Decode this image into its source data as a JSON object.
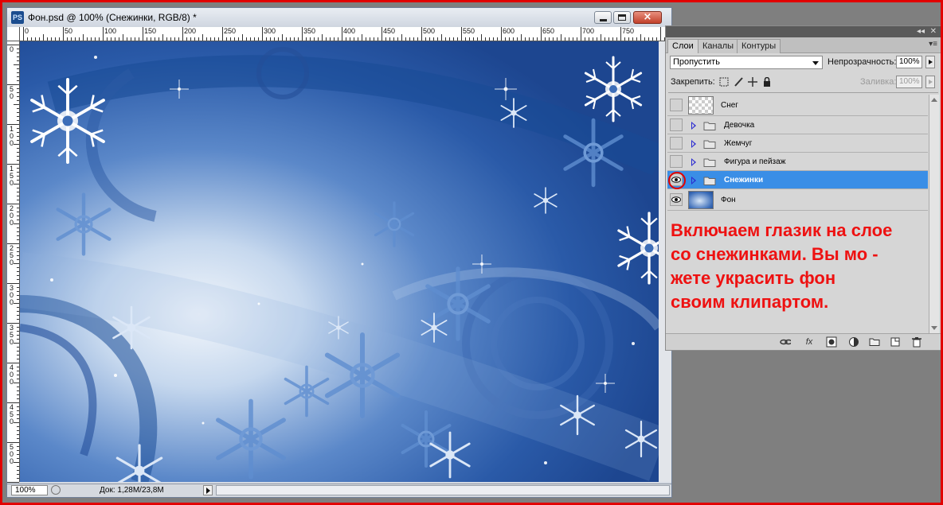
{
  "document_window": {
    "app_icon": "PS",
    "title": "Фон.psd @ 100% (Снежинки, RGB/8) *",
    "window_buttons": {
      "minimize": "minimize-icon",
      "maximize": "maximize-icon",
      "close": "close-icon"
    }
  },
  "ruler_top": {
    "labels": [
      "0",
      "50",
      "100",
      "150",
      "200",
      "250",
      "300",
      "350",
      "400",
      "450",
      "500",
      "550",
      "600",
      "650",
      "700",
      "750"
    ]
  },
  "ruler_left": {
    "labels": [
      "0",
      "50",
      "100",
      "150",
      "200",
      "250",
      "300",
      "350",
      "400",
      "450",
      "500"
    ]
  },
  "status_bar": {
    "zoom": "100%",
    "doc_info": "Док: 1,28M/23,8M"
  },
  "layers_panel": {
    "tabs": [
      {
        "label": "Слои",
        "active": true
      },
      {
        "label": "Каналы",
        "active": false
      },
      {
        "label": "Контуры",
        "active": false
      }
    ],
    "collapse_icon": "double-arrow-icon",
    "close_icon": "close-icon",
    "blend_mode": "Пропустить",
    "opacity_label": "Непрозрачность:",
    "opacity_value": "100%",
    "lock_label": "Закрепить:",
    "fill_label": "Заливка:",
    "fill_value": "100%",
    "layers": [
      {
        "name": "Снег",
        "type": "layer",
        "visible": false,
        "selected": false
      },
      {
        "name": "Девочка",
        "type": "group",
        "visible": false,
        "selected": false
      },
      {
        "name": "Жемчуг",
        "type": "group",
        "visible": false,
        "selected": false
      },
      {
        "name": "Фигура и пейзаж",
        "type": "group",
        "visible": false,
        "selected": false
      },
      {
        "name": "Снежинки",
        "type": "group",
        "visible": true,
        "selected": true
      },
      {
        "name": "Фон",
        "type": "layer",
        "visible": true,
        "selected": false
      }
    ],
    "footer_icons": [
      "link-icon",
      "fx-icon",
      "mask-icon",
      "adjustment-icon",
      "folder-icon",
      "new-layer-icon",
      "trash-icon"
    ]
  },
  "annotation": {
    "line1": "Включаем глазик на слое",
    "line2": "со снежинками. Вы мо -",
    "line3": "жете украсить фон",
    "line4": "своим клипартом."
  },
  "colors": {
    "annotation_red": "#ee1111",
    "selection_blue": "#3a8ee6",
    "canvas_blue": "#2a5db0"
  }
}
